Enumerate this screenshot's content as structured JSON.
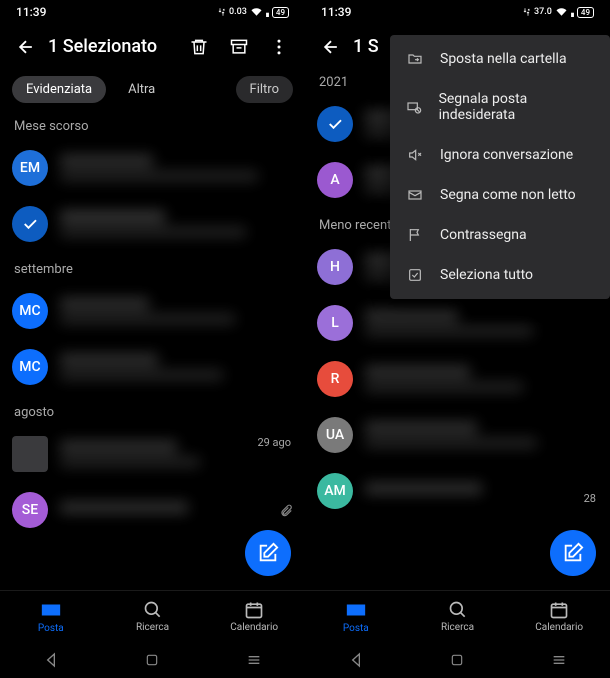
{
  "status": {
    "time": "11:39",
    "battery": "49"
  },
  "header": {
    "title": "1 Selezionato",
    "title2": "1 S"
  },
  "tabs": {
    "t1": "Evidenziata",
    "t2": "Altra",
    "filter": "Filtro"
  },
  "headers": {
    "h1": "Mese scorso",
    "h2": "settembre",
    "h3": "agosto",
    "h4": "2021",
    "h5": "Meno recenti"
  },
  "avatars": {
    "em": "EM",
    "mc": "MC",
    "se": "SE",
    "a": "A",
    "h": "H",
    "l": "L",
    "r": "R",
    "ua": "UA",
    "am": "AM"
  },
  "dates": {
    "d1": "29 ago",
    "d2": "28"
  },
  "menu": {
    "m1": "Sposta nella cartella",
    "m2": "Segnala posta indesiderata",
    "m3": "Ignora conversazione",
    "m4": "Segna come non letto",
    "m5": "Contrassegna",
    "m6": "Seleziona tutto"
  },
  "nav": {
    "mail": "Posta",
    "search": "Ricerca",
    "calendar": "Calendario"
  }
}
